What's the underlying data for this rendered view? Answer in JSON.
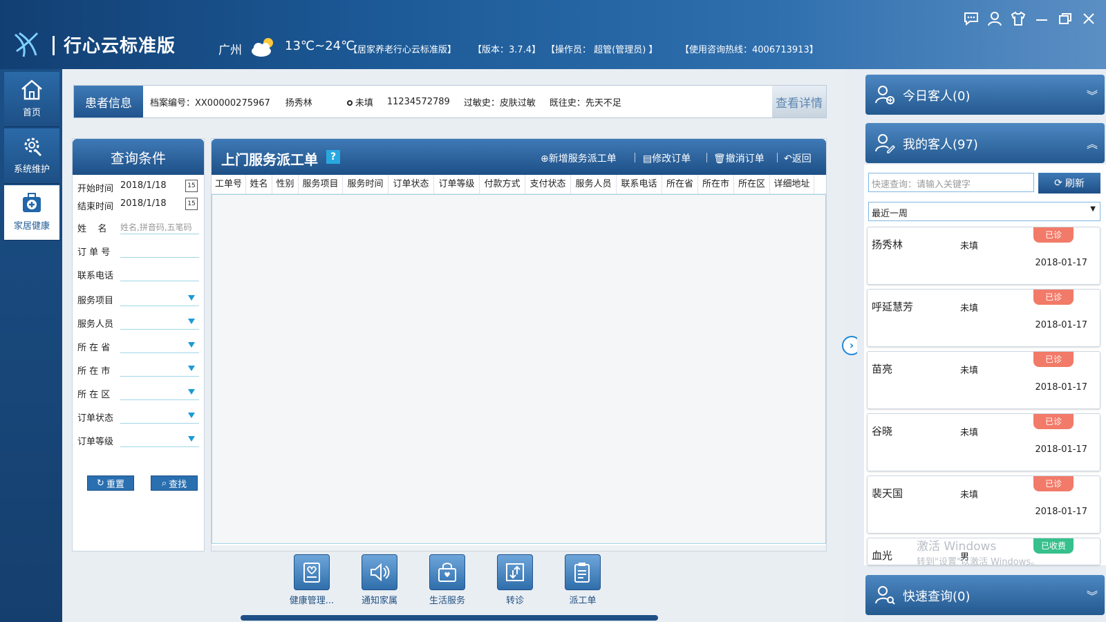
{
  "header": {
    "app_title": "行心云标准版",
    "city": "广州",
    "temperature": "13℃~24℃",
    "product": "【居家养老行心云标准版】",
    "version": "【版本：3.7.4】",
    "operator": "【操作员：  超管(管理员) 】",
    "hotline": "【使用咨询热线：4006713913】"
  },
  "window_controls": [
    "chat-icon",
    "user-icon",
    "shirt-icon",
    "minimize-icon",
    "restore-icon",
    "close-icon"
  ],
  "nav": {
    "items": [
      {
        "label": "首页",
        "icon": "home-icon"
      },
      {
        "label": "系统维护",
        "icon": "gear-icon"
      },
      {
        "label": "家居健康",
        "icon": "medkit-icon"
      }
    ]
  },
  "patient": {
    "tag": "患者信息",
    "file_no": "档案编号：XX00000275967",
    "name": "扬秀林",
    "gender": "未填",
    "phone": "11234572789",
    "allergy": "过敏史：皮肤过敏",
    "history": "既往史：先天不足",
    "detail_button": "查看详情"
  },
  "query": {
    "title": "查询条件",
    "start_label": "开始时间",
    "start_value": "2018/1/18",
    "end_label": "结束时间",
    "end_value": "2018/1/18",
    "calendar_mark": "15",
    "name_label": "姓    名",
    "name_placeholder": "姓名,拼音码,五笔码",
    "order_label": "订 单 号",
    "phone_label": "联系电话",
    "service_label": "服务项目",
    "staff_label": "服务人员",
    "province_label": "所 在 省",
    "city_label": "所 在 市",
    "district_label": "所 在 区",
    "status_label": "订单状态",
    "level_label": "订单等级",
    "reset_button": "重置",
    "search_button": "查找"
  },
  "orders": {
    "title": "上门服务派工单",
    "help": "?",
    "add": "新增服务派工单",
    "edit": "修改订单",
    "cancel": "撤消订单",
    "back": "返回",
    "columns": [
      "工单号",
      "姓名",
      "性别",
      "服务项目",
      "服务时间",
      "订单状态",
      "订单等级",
      "付款方式",
      "支付状态",
      "服务人员",
      "联系电话",
      "所在省",
      "所在市",
      "所在区",
      "详细地址"
    ]
  },
  "dock": [
    {
      "label": "健康管理...",
      "icon": "clipboard-icon"
    },
    {
      "label": "通知家属",
      "icon": "speaker-icon"
    },
    {
      "label": "生活服务",
      "icon": "bag-icon"
    },
    {
      "label": "转诊",
      "icon": "transfer-icon"
    },
    {
      "label": "派工单",
      "icon": "worksheet-icon"
    }
  ],
  "right_panel": {
    "today": "今日客人(0)",
    "mine": "我的客人(97)",
    "quick": "快速查询(0)",
    "search_placeholder": "快速查询：请输入关键字",
    "refresh": "刷新",
    "range": "最近一周",
    "customers": [
      {
        "name": "扬秀林",
        "gender": "未填",
        "date": "2018-01-17",
        "badge": "已诊"
      },
      {
        "name": "呼延慧芳",
        "gender": "未填",
        "date": "2018-01-17",
        "badge": "已诊"
      },
      {
        "name": "苗亮",
        "gender": "未填",
        "date": "2018-01-17",
        "badge": "已诊"
      },
      {
        "name": "谷晓",
        "gender": "未填",
        "date": "2018-01-17",
        "badge": "已诊"
      },
      {
        "name": "裴天国",
        "gender": "未填",
        "date": "2018-01-17",
        "badge": "已诊"
      },
      {
        "name": "血光",
        "gender": "男",
        "date": "",
        "badge": "已收费"
      }
    ],
    "watermark_1": "激活 Windows",
    "watermark_2": "转到\"设置\"以激活 Windows。"
  },
  "colors": {
    "header": "#1c5a97",
    "panel_head": "#2a64a0",
    "badge_seen": "#f27a68",
    "badge_paid": "#36c08c",
    "accent": "#1e88d8"
  }
}
